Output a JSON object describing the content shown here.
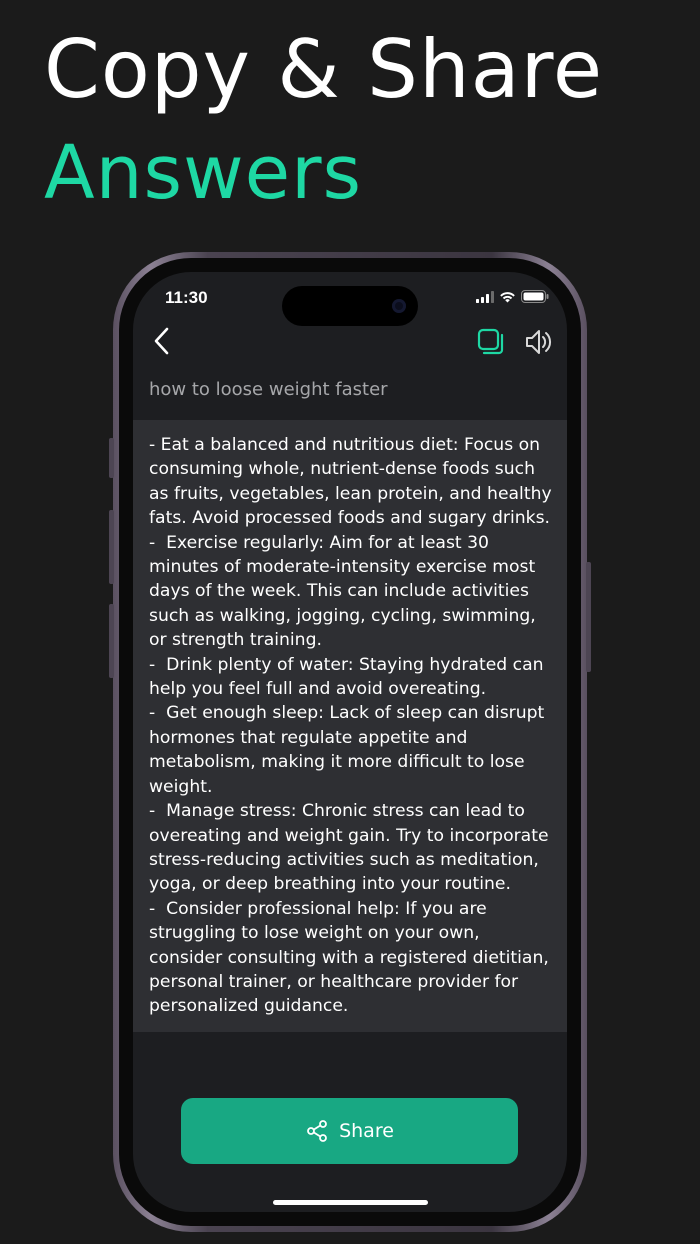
{
  "headline": {
    "line1": "Copy & Share",
    "line2": "Answers",
    "accent_color": "#1ed8a4"
  },
  "status_bar": {
    "time": "11:30",
    "icons": [
      "cellular-signal-icon",
      "wifi-icon",
      "battery-icon"
    ]
  },
  "toolbar": {
    "back_icon": "chevron-left-icon",
    "copy_icon": "copy-icon",
    "speaker_icon": "speaker-icon"
  },
  "question": "how to loose weight faster",
  "answer": "- Eat a balanced and nutritious diet: Focus on consuming whole, nutrient-dense foods such as fruits, vegetables, lean protein, and healthy fats. Avoid processed foods and sugary drinks.\n-  Exercise regularly: Aim for at least 30 minutes of moderate-intensity exercise most days of the week. This can include activities such as walking, jogging, cycling, swimming, or strength training.\n-  Drink plenty of water: Staying hydrated can help you feel full and avoid overeating.\n-  Get enough sleep: Lack of sleep can disrupt hormones that regulate appetite and metabolism, making it more difficult to lose weight.\n-  Manage stress: Chronic stress can lead to overeating and weight gain. Try to incorporate stress-reducing activities such as meditation, yoga, or deep breathing into your routine.\n-  Consider professional help: If you are struggling to lose weight on your own, consider consulting with a registered dietitian, personal trainer, or healthcare provider for personalized guidance.",
  "share_button": {
    "label": "Share",
    "icon": "share-icon",
    "color": "#18a883"
  }
}
